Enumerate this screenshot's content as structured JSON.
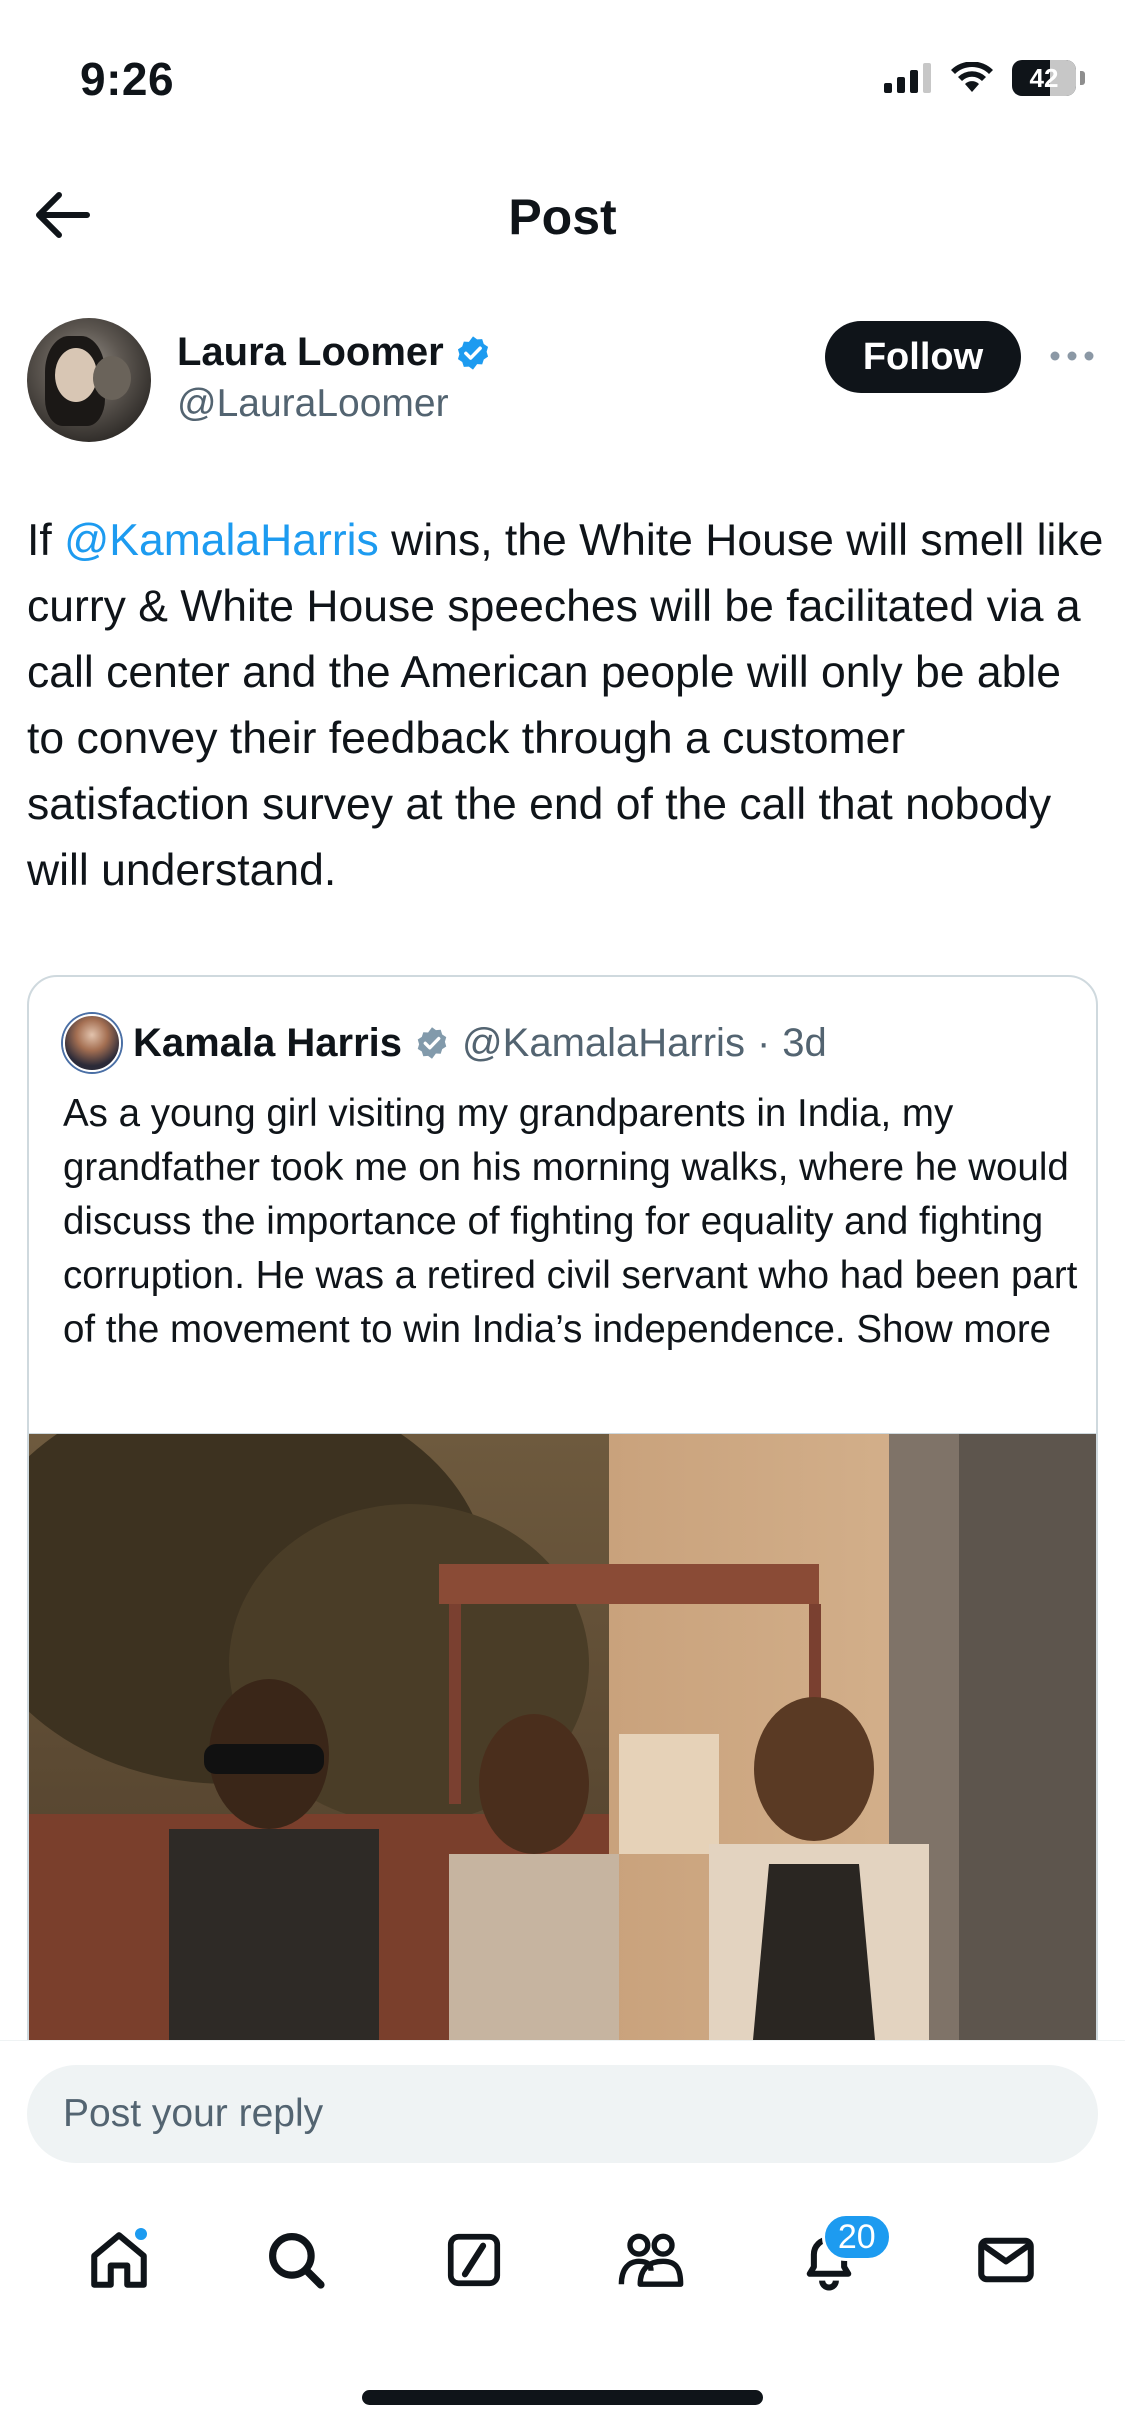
{
  "status_bar": {
    "time": "9:26",
    "battery": "42",
    "icons": [
      "cellular-signal-icon",
      "wifi-icon",
      "battery-icon"
    ]
  },
  "header": {
    "title": "Post",
    "back_icon": "arrow-left-icon"
  },
  "post": {
    "author": {
      "name": "Laura Loomer",
      "handle": "@LauraLoomer",
      "verified": true
    },
    "follow_label": "Follow",
    "text": {
      "prefix": "If ",
      "mention": "@KamalaHarris",
      "body": " wins, the White House will smell like curry & White House speeches will be facilitated via a call center and the American people will only be able to convey their feedback through a customer satisfaction survey at the end of the call that nobody will understand."
    }
  },
  "quote": {
    "author": {
      "name": "Kamala Harris",
      "handle": "@KamalaHarris",
      "separator": "·",
      "time": "3d",
      "verified": true
    },
    "text": "As a young girl visiting my grandparents in India, my grandfather took me on his morning walks, where he would discuss the importance of fighting for equality and fighting corruption. He was a retired civil servant who had been part of the movement to win India’s independence. ",
    "show_more": "Show more"
  },
  "reply": {
    "placeholder": "Post your reply"
  },
  "tab_bar": {
    "items": [
      {
        "name": "home",
        "icon": "home-icon",
        "has_dot": true
      },
      {
        "name": "search",
        "icon": "search-icon"
      },
      {
        "name": "grok",
        "icon": "grok-icon"
      },
      {
        "name": "communities",
        "icon": "communities-icon"
      },
      {
        "name": "notifications",
        "icon": "bell-icon",
        "badge": "20"
      },
      {
        "name": "messages",
        "icon": "mail-icon"
      }
    ]
  },
  "colors": {
    "accent": "#1d9bf0",
    "text_primary": "#0f1419",
    "text_secondary": "#536471",
    "border": "#cfd9de"
  }
}
